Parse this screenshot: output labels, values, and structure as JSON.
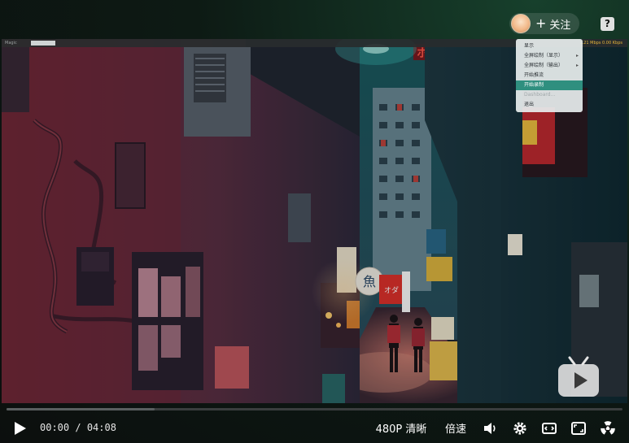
{
  "header": {
    "follow_label": "关注",
    "follow_plus": "+",
    "help_label": "?"
  },
  "embedded_app": {
    "toolbar_left_label": "Magic",
    "status_text": "1.21 Mbps 0.00 Kbps",
    "context_menu": {
      "items": [
        {
          "label": "显示",
          "state": "normal",
          "submenu": false
        },
        {
          "label": "全屏绘制（显示）",
          "state": "normal",
          "submenu": true
        },
        {
          "label": "全屏绘制（输出）",
          "state": "normal",
          "submenu": true
        },
        {
          "label": "开始推流",
          "state": "normal",
          "submenu": false
        },
        {
          "label": "开始录制",
          "state": "active",
          "submenu": false
        },
        {
          "label": "Dashboard...",
          "state": "disabled",
          "submenu": false
        },
        {
          "label": "退出",
          "state": "normal",
          "submenu": false
        }
      ]
    },
    "scene_signs": {
      "top_sign": "ホ",
      "lantern": "魚",
      "red_sign": "オダ"
    }
  },
  "player": {
    "progress": 0.24,
    "time_current": "00:00",
    "time_separator": "/",
    "time_total": "04:08",
    "quality_label": "480P 清晰",
    "speed_label": "倍速",
    "icons": {
      "play": "play-icon",
      "volume": "volume-icon",
      "settings": "gear-icon",
      "widescreen": "widescreen-icon",
      "fullscreen": "fullscreen-icon",
      "radiation": "radiation-icon",
      "logo": "bilibili-tv-icon"
    }
  },
  "colors": {
    "accent_menu": "#2f8f7f",
    "neon_red": "#e0312b",
    "teal_light": "#3fc6c0"
  }
}
